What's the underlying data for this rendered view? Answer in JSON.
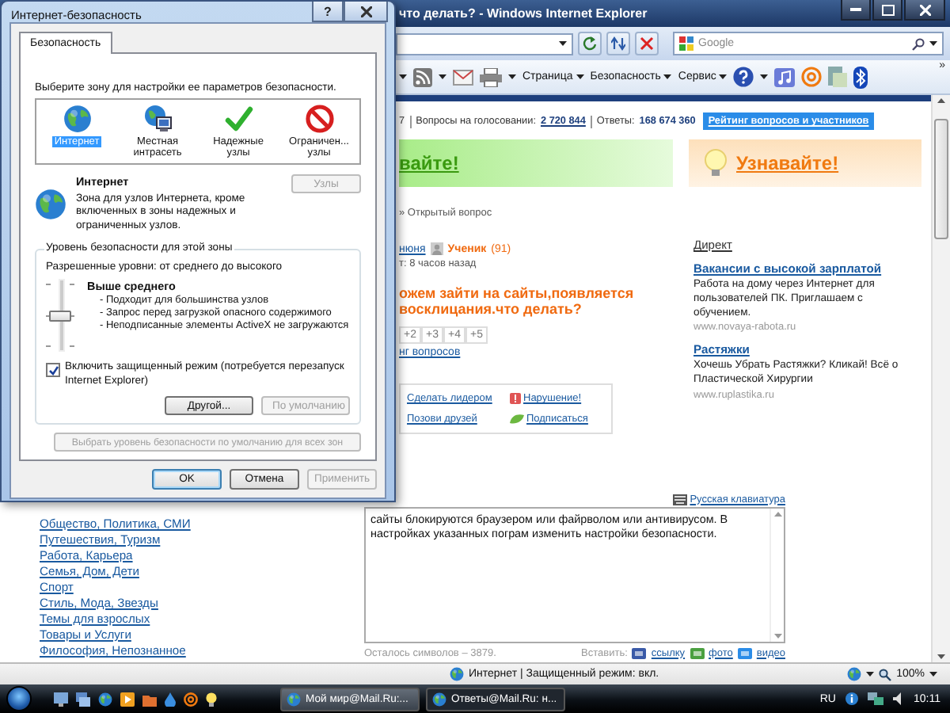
{
  "dialog": {
    "title": "Интернет-безопасность",
    "help_button": "?",
    "tabs": [
      {
        "label": "Безопасность",
        "selected": true
      }
    ],
    "zone_prompt": "Выберите зону для настройки ее параметров безопасности.",
    "zones": [
      {
        "label": "Интернет",
        "kind": "internet",
        "selected": true
      },
      {
        "label": "Местная интрасеть",
        "kind": "intranet",
        "selected": false
      },
      {
        "label": "Надежные узлы",
        "kind": "trusted",
        "selected": false
      },
      {
        "label": "Ограничен... узлы",
        "kind": "restricted",
        "selected": false
      }
    ],
    "zone_info": {
      "title": "Интернет",
      "description": "Зона для узлов Интернета, кроме включенных в зоны надежных и ограниченных узлов."
    },
    "sites_button": {
      "label": "Узлы",
      "disabled": true
    },
    "security": {
      "title": "Уровень безопасности для этой зоны",
      "allowed": "Разрешенные уровни: от среднего до высокого",
      "level": 0.5,
      "level_name": "Выше среднего",
      "bullets": [
        "- Подходит для большинства узлов",
        "- Запрос перед загрузкой опасного содержимого",
        "- Неподписанные элементы ActiveX не загружаются"
      ]
    },
    "protected_mode": {
      "label": "Включить защищенный режим (потребуется перезапуск Internet Explorer)",
      "checked": true
    },
    "group_buttons": [
      {
        "label": "Другой...",
        "disabled": false
      },
      {
        "label": "По умолчанию",
        "disabled": true
      }
    ],
    "reset_all_button": {
      "label": "Выбрать уровень безопасности по умолчанию для всех зон",
      "disabled": true
    },
    "footer_buttons": [
      {
        "label": "OK",
        "disabled": false,
        "default": true
      },
      {
        "label": "Отмена",
        "disabled": false,
        "default": false
      },
      {
        "label": "Применить",
        "disabled": true,
        "default": false
      }
    ]
  },
  "browser": {
    "title": "что делать? - Windows Internet Explorer",
    "search_placeholder": "Google",
    "commands": [
      "Страница",
      "Безопасность",
      "Сервис"
    ],
    "overflow": "»",
    "page": {
      "stats": {
        "lead": "7",
        "votes_label": "Вопросы на голосовании:",
        "votes": "2 720 844",
        "answers_label": "Ответы:",
        "answers": "168 674 360"
      },
      "rating_badge": "Рейтинг вопросов и участников",
      "banners": [
        {
          "text": "вайте!",
          "kind": "green"
        },
        {
          "text": "Узнавайте!",
          "kind": "orange"
        }
      ],
      "breadcrumb": "» Открытый вопрос",
      "author": "нюня",
      "rank": "Ученик",
      "points": "(91)",
      "time": "т: 8 часов назад",
      "question_lines": [
        "ожем зайти на сайты,появляется",
        "восклицания.что делать?"
      ],
      "votes": [
        "+2",
        "+3",
        "+4",
        "+5"
      ],
      "rating_link": "нг вопросов",
      "actions": [
        {
          "label": "Сделать лидером",
          "kind": "plain"
        },
        {
          "label": "Нарушение!",
          "kind": "flag"
        },
        {
          "label": "Позови друзей",
          "kind": "plain"
        },
        {
          "label": "Подписаться",
          "kind": "subscribe"
        }
      ],
      "ads_title": "Директ",
      "ads": [
        {
          "title": "Вакансии с высокой зарплатой",
          "text": "Работа на дому через Интернет для пользователей ПК. Приглашаем с обучением.",
          "url": "www.novaya-rabota.ru"
        },
        {
          "title": "Растяжки",
          "text": "Хочешь Убрать Растяжки? Кликай! Всё о Пластической Хирургии",
          "url": "www.ruplastika.ru"
        }
      ],
      "keyboard_link": "Русская клавиатура",
      "categories": [
        "Общество, Политика, СМИ",
        "Путешествия, Туризм",
        "Работа, Карьера",
        "Семья, Дом, Дети",
        "Спорт",
        "Стиль, Мода, Звезды",
        "Темы для взрослых",
        "Товары и Услуги",
        "Философия, Непознанное"
      ],
      "answer_text": "сайты блокируются браузером или файрволом или антивирусом. В настройках указанных пограм изменить настройки безопасности.",
      "chars_left": "Осталось символов – 3879.",
      "insert_label": "Вставить:",
      "insert_links": [
        {
          "label": "ссылку",
          "kind": "link"
        },
        {
          "label": "фото",
          "kind": "photo"
        },
        {
          "label": "видео",
          "kind": "video"
        }
      ]
    },
    "status": {
      "zone": "Интернет | Защищенный режим: вкл.",
      "zoom": "100%"
    }
  },
  "taskbar": {
    "tasks": [
      {
        "label": "Мой мир@Mail.Ru:...",
        "selected": true
      },
      {
        "label": "Ответы@Mail.Ru: н...",
        "selected": false
      }
    ],
    "language": "RU",
    "clock": "10:11"
  }
}
